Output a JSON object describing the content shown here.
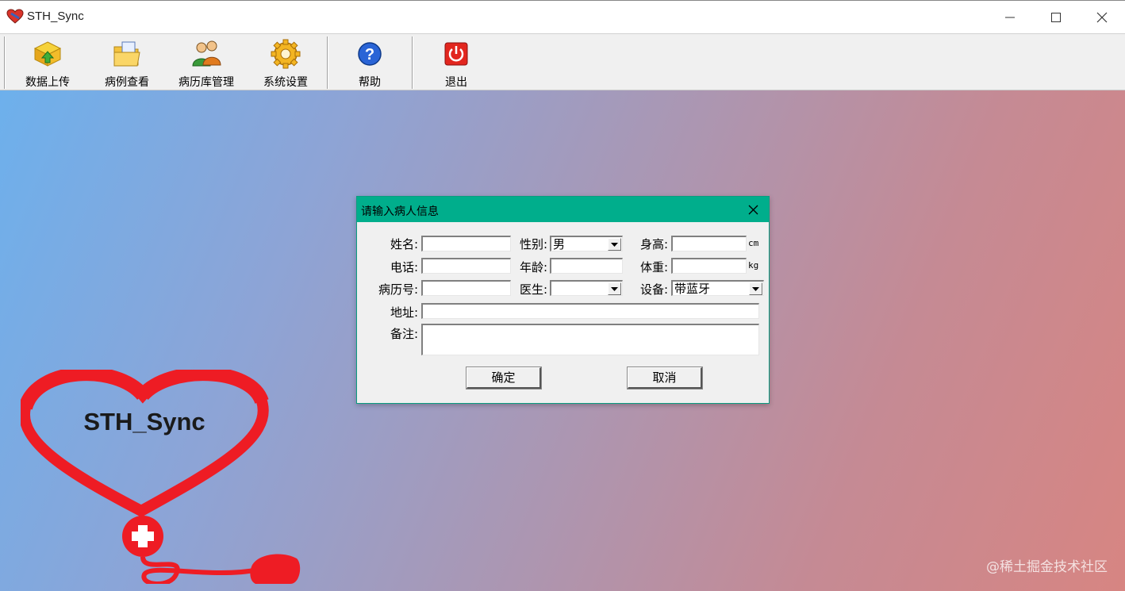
{
  "window": {
    "title": "STH_Sync"
  },
  "toolbar": {
    "items": [
      {
        "label": "数据上传",
        "icon": "upload-icon"
      },
      {
        "label": "病例查看",
        "icon": "folder-icon"
      },
      {
        "label": "病历库管理",
        "icon": "users-icon"
      },
      {
        "label": "系统设置",
        "icon": "gear-icon"
      },
      {
        "label": "帮助",
        "icon": "help-icon"
      },
      {
        "label": "退出",
        "icon": "power-icon"
      }
    ]
  },
  "logo": {
    "text": "STH_Sync"
  },
  "watermark": "@稀土掘金技术社区",
  "dialog": {
    "title": "请输入病人信息",
    "fields": {
      "name": {
        "label": "姓名:",
        "value": ""
      },
      "gender": {
        "label": "性别:",
        "value": "男"
      },
      "height": {
        "label": "身高:",
        "value": "",
        "unit": "cm"
      },
      "phone": {
        "label": "电话:",
        "value": ""
      },
      "age": {
        "label": "年龄:",
        "value": ""
      },
      "weight": {
        "label": "体重:",
        "value": "",
        "unit": "kg"
      },
      "record_no": {
        "label": "病历号:",
        "value": ""
      },
      "doctor": {
        "label": "医生:",
        "value": ""
      },
      "device": {
        "label": "设备:",
        "value": "带蓝牙"
      },
      "address": {
        "label": "地址:",
        "value": ""
      },
      "notes": {
        "label": "备注:",
        "value": ""
      }
    },
    "ok_label": "确定",
    "cancel_label": "取消"
  },
  "colors": {
    "dialog_title_bg": "#00ae8c",
    "logo_red": "#ee1c24"
  }
}
